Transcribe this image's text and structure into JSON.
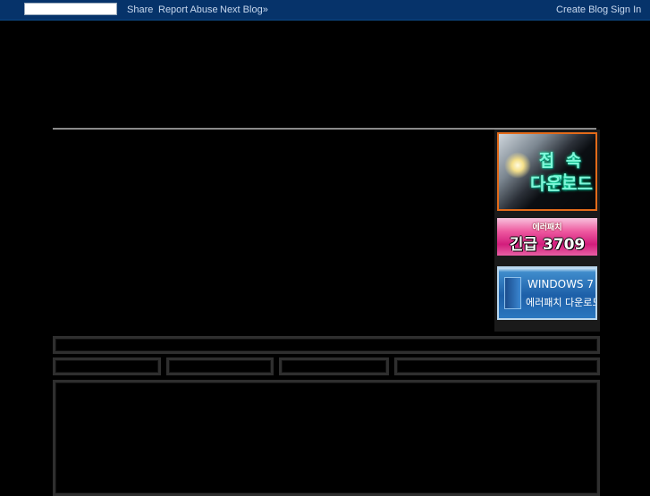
{
  "navbar": {
    "search_value": "",
    "links": {
      "share": "Share",
      "report_abuse": "Report Abuse",
      "next_blog": "Next Blog»",
      "create_blog": "Create Blog",
      "sign_in": "Sign In"
    },
    "background_color": "#06336a"
  },
  "sidebar": {
    "banners": [
      {
        "line1": "접 속 기",
        "line2": "다운로드",
        "border_color": "#e36b1a"
      },
      {
        "line1": "에러패치",
        "line2": "긴급 3709",
        "color": "#e85fa4"
      },
      {
        "line1": "WINDOWS 7",
        "line2": "에러패치 다운로드",
        "color": "#1d5fa8"
      }
    ]
  }
}
